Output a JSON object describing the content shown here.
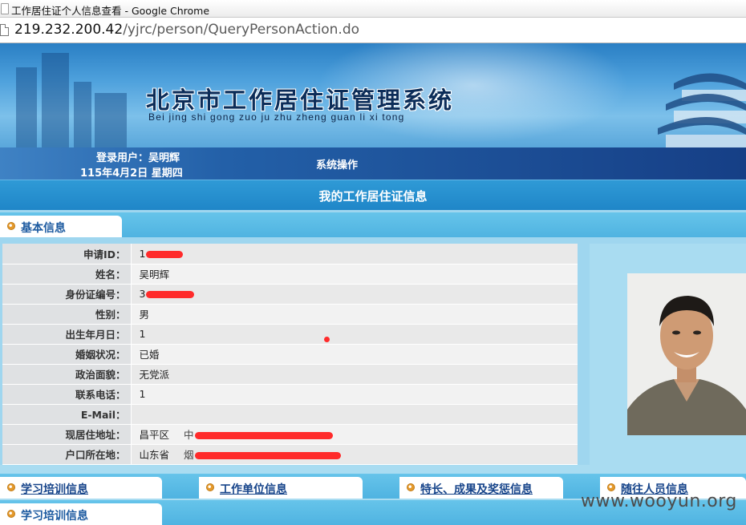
{
  "browser": {
    "window_title": "工作居住证个人信息查看 - Google Chrome",
    "url_host": "219.232.200.42",
    "url_path": "/yjrc/person/QueryPersonAction.do"
  },
  "banner": {
    "title": "北京市工作居住证管理系统",
    "subtitle": "Bei jing shi gong zuo ju zhu zheng guan li xi tong"
  },
  "userbar": {
    "login_user": "登录用户：吴明辉",
    "date": "115年4月2日 星期四",
    "system_operation": "系统操作"
  },
  "page_title": "我的工作居住证信息",
  "section_tab": "基本信息",
  "person": {
    "rows": [
      {
        "label": "申请ID：",
        "value": "1",
        "redacted": true
      },
      {
        "label": "姓名：",
        "value": "吴明辉",
        "redacted": false
      },
      {
        "label": "身份证编号：",
        "value": "3",
        "redacted": true
      },
      {
        "label": "性别：",
        "value": "男",
        "redacted": false
      },
      {
        "label": "出生年月日：",
        "value": "1",
        "redacted": true
      },
      {
        "label": "婚姻状况：",
        "value": "已婚",
        "redacted": false
      },
      {
        "label": "政治面貌：",
        "value": "无党派",
        "redacted": false
      },
      {
        "label": "联系电话：",
        "value": "1",
        "redacted": true
      },
      {
        "label": "E-Mail：",
        "value": "",
        "redacted": false
      },
      {
        "label": "现居住地址：",
        "value": "昌平区",
        "extra": "中",
        "redacted": true
      },
      {
        "label": "户口所在地：",
        "value": "山东省",
        "extra": "烟",
        "redacted": true
      }
    ]
  },
  "bottom_tabs": {
    "training": "学习培训信息",
    "employer": "工作单位信息",
    "awards": "特长、成果及奖惩信息",
    "family": "随往人员信息",
    "training_repeat": "学习培训信息"
  },
  "watermark": "www.wooyun.org",
  "colors": {
    "header_blue": "#1f86c8",
    "userbar_blue": "#163f86",
    "tab_text": "#1c5aa0",
    "redaction": "#ff2b2b"
  }
}
